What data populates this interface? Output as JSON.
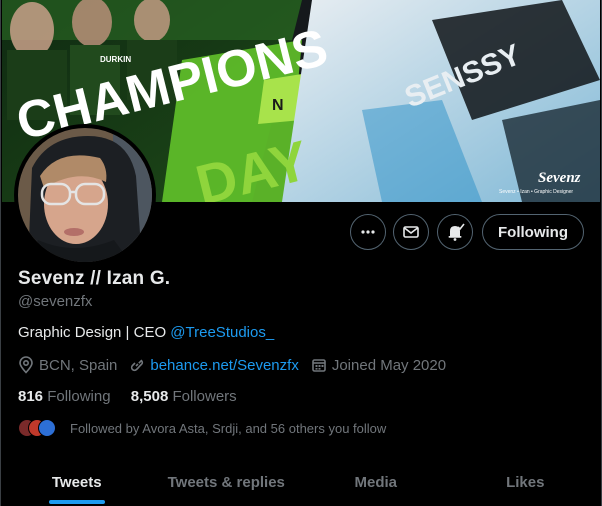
{
  "profile": {
    "display_name": "Sevenz // Izan G.",
    "handle": "@sevenzfx",
    "bio_text": "Graphic Design  | CEO ",
    "bio_mention": "@TreeStudios_",
    "location": "BCN, Spain",
    "website": "behance.net/Sevenzfx",
    "joined": "Joined May 2020"
  },
  "actions": {
    "following_label": "Following"
  },
  "stats": {
    "following_count": "816",
    "following_label": "Following",
    "followers_count": "8,508",
    "followers_label": "Followers"
  },
  "followed_by": "Followed by Avora Asta, Srdji, and 56 others you follow",
  "banner": {
    "text_champions": "CHAMPIONS",
    "text_senssy": "SENSSY",
    "text_day": "DAY",
    "sponsor_text": "DURKIN",
    "logo_text": "Sevenz",
    "tagline": "Sevenz • Izan • Graphic Designer"
  },
  "tabs": [
    {
      "label": "Tweets",
      "active": true
    },
    {
      "label": "Tweets & replies",
      "active": false
    },
    {
      "label": "Media",
      "active": false
    },
    {
      "label": "Likes",
      "active": false
    }
  ],
  "colors": {
    "accent": "#1d9bf0",
    "banner_green": "#6fcf2e",
    "background": "#000000"
  }
}
